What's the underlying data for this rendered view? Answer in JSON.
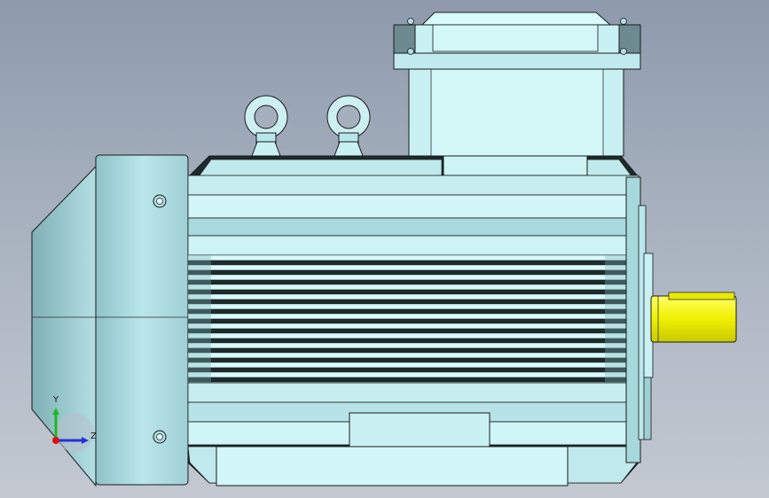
{
  "viewport": {
    "background_top": "#8e9aac",
    "background_bottom": "#c3c8d1"
  },
  "model": {
    "name": "electric-motor",
    "body_color": "#c9f1f3",
    "body_shade": "#a6d8dc",
    "shaft_color": "#f2f200",
    "edge_color": "#1a1a1a"
  },
  "triad": {
    "y_label": "Y",
    "z_label": "Z",
    "y_color": "#1fb81f",
    "z_color": "#2233dd",
    "x_color": "#dd1111"
  }
}
